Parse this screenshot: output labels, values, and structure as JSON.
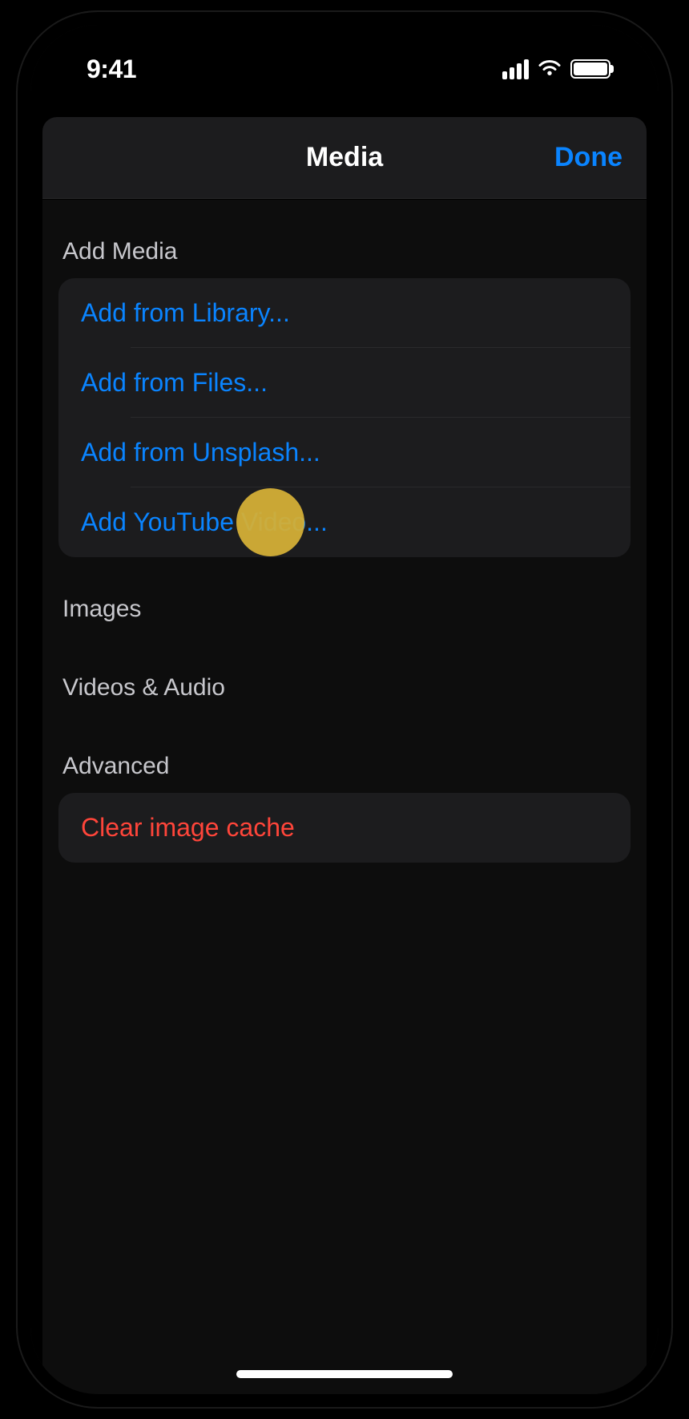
{
  "status": {
    "time": "9:41"
  },
  "nav": {
    "title": "Media",
    "done": "Done"
  },
  "sections": {
    "add_media": {
      "header": "Add Media",
      "items": [
        "Add from Library...",
        "Add from Files...",
        "Add from Unsplash...",
        "Add YouTube Video..."
      ]
    },
    "images": {
      "header": "Images"
    },
    "videos_audio": {
      "header": "Videos & Audio"
    },
    "advanced": {
      "header": "Advanced",
      "items": [
        "Clear image cache"
      ]
    }
  }
}
